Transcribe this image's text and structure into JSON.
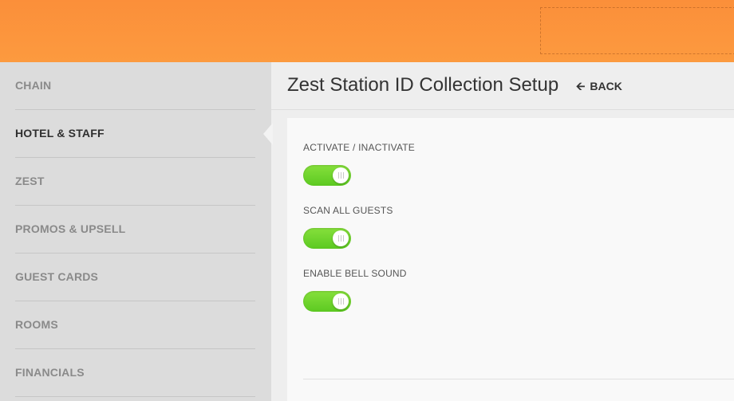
{
  "header": {},
  "sidebar": {
    "items": [
      {
        "label": "CHAIN"
      },
      {
        "label": "HOTEL & STAFF"
      },
      {
        "label": "ZEST"
      },
      {
        "label": "PROMOS & UPSELL"
      },
      {
        "label": "GUEST CARDS"
      },
      {
        "label": "ROOMS"
      },
      {
        "label": "FINANCIALS"
      }
    ],
    "active_index": 1
  },
  "main": {
    "title": "Zest Station ID Collection Setup",
    "back_label": "BACK",
    "back_icon": "arrow-left-icon",
    "settings": [
      {
        "label": "ACTIVATE / INACTIVATE",
        "enabled": true
      },
      {
        "label": "SCAN ALL GUESTS",
        "enabled": true
      },
      {
        "label": "ENABLE BELL SOUND",
        "enabled": true
      }
    ]
  },
  "colors": {
    "header_orange": "#fb8f3a",
    "toggle_green": "#6fd62e",
    "sidebar_bg": "#dcdcdc"
  }
}
